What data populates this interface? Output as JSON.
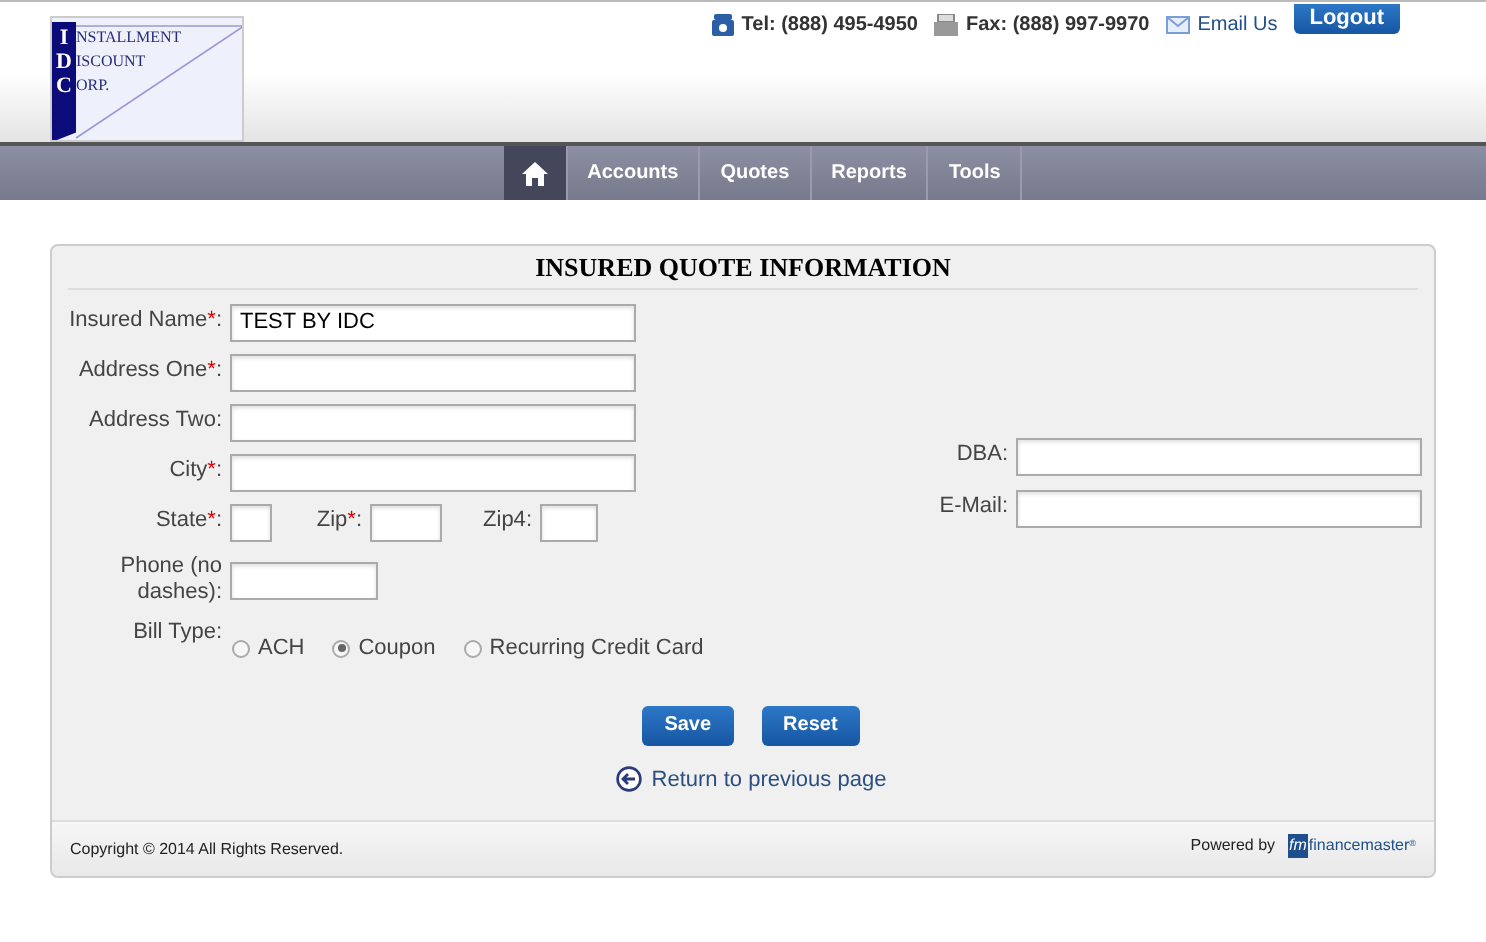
{
  "logo": {
    "initials": [
      "I",
      "D",
      "C"
    ],
    "rest": [
      "NSTALLMENT",
      "ISCOUNT",
      "ORP."
    ]
  },
  "contact": {
    "tel": "Tel: (888) 495-4950",
    "fax": "Fax: (888) 997-9970",
    "email": "Email Us",
    "logout": "Logout"
  },
  "nav": {
    "items": [
      {
        "kind": "home",
        "selected": true
      },
      {
        "kind": "text",
        "label": "Accounts",
        "selected": false
      },
      {
        "kind": "text",
        "label": "Quotes",
        "selected": false
      },
      {
        "kind": "text",
        "label": "Reports",
        "selected": false
      },
      {
        "kind": "text",
        "label": "Tools",
        "selected": false
      }
    ]
  },
  "form": {
    "title": "INSURED QUOTE INFORMATION",
    "required_mark": "*",
    "colon": ":",
    "left": [
      {
        "kind": "wide",
        "fields": [
          {
            "label": "Insured Name",
            "required": true,
            "value": "TEST BY IDC"
          }
        ]
      },
      {
        "kind": "wide",
        "fields": [
          {
            "label": "Address One",
            "required": true
          }
        ]
      },
      {
        "kind": "wide",
        "fields": [
          {
            "label": "Address Two",
            "required": false
          }
        ]
      },
      {
        "kind": "wide",
        "fields": [
          {
            "label": "City",
            "required": true
          }
        ]
      },
      {
        "kind": "multi",
        "fields": [
          {
            "label": "State",
            "required": true
          },
          {
            "label": "Zip",
            "required": true
          },
          {
            "label": "Zip4",
            "required": false
          }
        ]
      },
      {
        "kind": "phone",
        "fields": [
          {
            "label": "Phone (no dashes)",
            "required": false
          }
        ]
      }
    ],
    "right": [
      {
        "label": "DBA"
      },
      {
        "label": "E-Mail"
      }
    ],
    "bill_type": {
      "label": "Bill Type",
      "options": [
        {
          "label": "ACH",
          "selected": false
        },
        {
          "label": "Coupon",
          "selected": true
        },
        {
          "label": "Recurring Credit Card",
          "selected": false
        }
      ]
    },
    "buttons": [
      "Save",
      "Reset"
    ],
    "back_link": "Return to previous page"
  },
  "footer": {
    "copyright": "Copyright © 2014 All Rights Reserved.",
    "powered": "Powered by",
    "brand_mark": "fm",
    "brand": "financemaster",
    "brand_suffix": "$^{®}$"
  }
}
